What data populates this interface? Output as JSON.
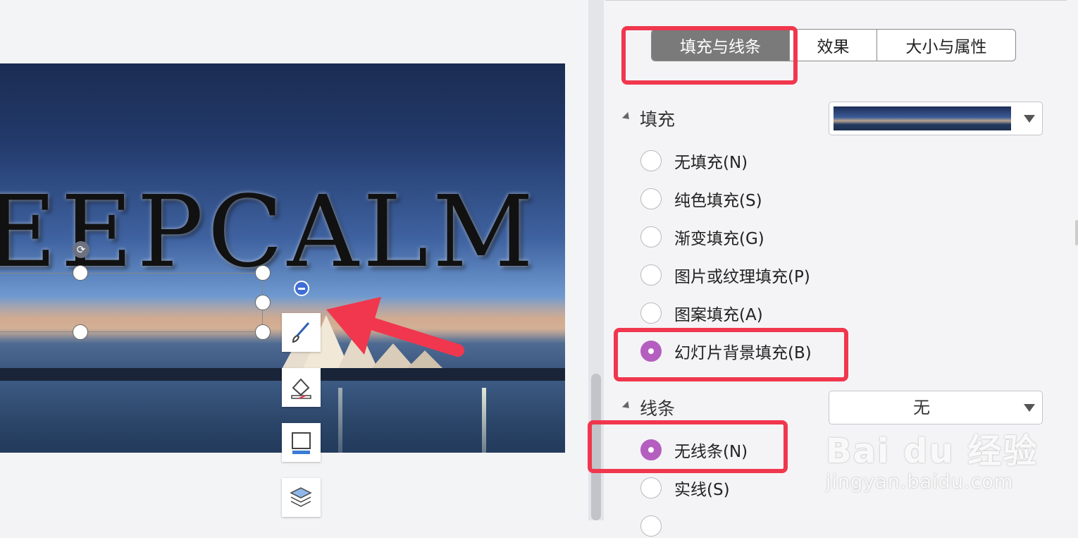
{
  "slide": {
    "title_text": "EEPCALM"
  },
  "panel": {
    "tabs": [
      {
        "label": "填充与线条",
        "active": true
      },
      {
        "label": "效果",
        "active": false
      },
      {
        "label": "大小与属性",
        "active": false
      }
    ],
    "fill": {
      "heading": "填充",
      "options": [
        {
          "label": "无填充(N)",
          "checked": false
        },
        {
          "label": "纯色填充(S)",
          "checked": false
        },
        {
          "label": "渐变填充(G)",
          "checked": false
        },
        {
          "label": "图片或纹理填充(P)",
          "checked": false
        },
        {
          "label": "图案填充(A)",
          "checked": false
        },
        {
          "label": "幻灯片背景填充(B)",
          "checked": true
        }
      ]
    },
    "line": {
      "heading": "线条",
      "dropdown_value": "无",
      "options": [
        {
          "label": "无线条(N)",
          "checked": true
        },
        {
          "label": "实线(S)",
          "checked": false
        }
      ]
    }
  },
  "watermark": {
    "main": "Bai du 经验",
    "sub": "jingyan.baidu.com"
  },
  "colors": {
    "highlight": "#f0374d",
    "radio_checked": "#b45fc0",
    "active_tab": "#7a7a7a"
  }
}
